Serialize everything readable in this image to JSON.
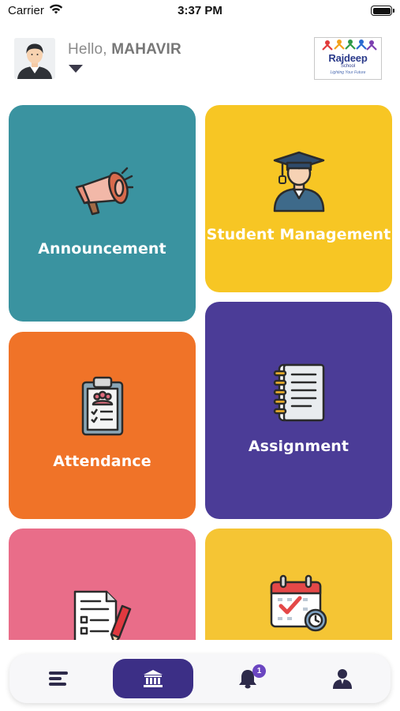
{
  "status_bar": {
    "carrier": "Carrier",
    "time": "3:37 PM"
  },
  "header": {
    "greeting_prefix": "Hello, ",
    "user_name": "MAHAVIR",
    "logo": {
      "name": "Rajdeep",
      "sub": "School",
      "tagline": "Lighting Your Future"
    }
  },
  "tiles": [
    {
      "label": "Announcement",
      "icon": "megaphone-icon",
      "color": "#3a93a0"
    },
    {
      "label": "Student Management",
      "icon": "graduate-icon",
      "color": "#f7c624"
    },
    {
      "label": "Attendance",
      "icon": "clipboard-icon",
      "color": "#f07328"
    },
    {
      "label": "Assignment",
      "icon": "notebook-icon",
      "color": "#4b3c97"
    },
    {
      "label": "",
      "icon": "document-pen-icon",
      "color": "#e96d89"
    },
    {
      "label": "",
      "icon": "calendar-icon",
      "color": "#f5c534"
    }
  ],
  "bottom_nav": {
    "items": [
      {
        "icon": "menu-icon",
        "active": false
      },
      {
        "icon": "institution-icon",
        "active": true
      },
      {
        "icon": "bell-icon",
        "active": false,
        "badge": "1"
      },
      {
        "icon": "profile-icon",
        "active": false
      }
    ],
    "active_color": "#3c2f86",
    "badge_color": "#6b46c1"
  }
}
